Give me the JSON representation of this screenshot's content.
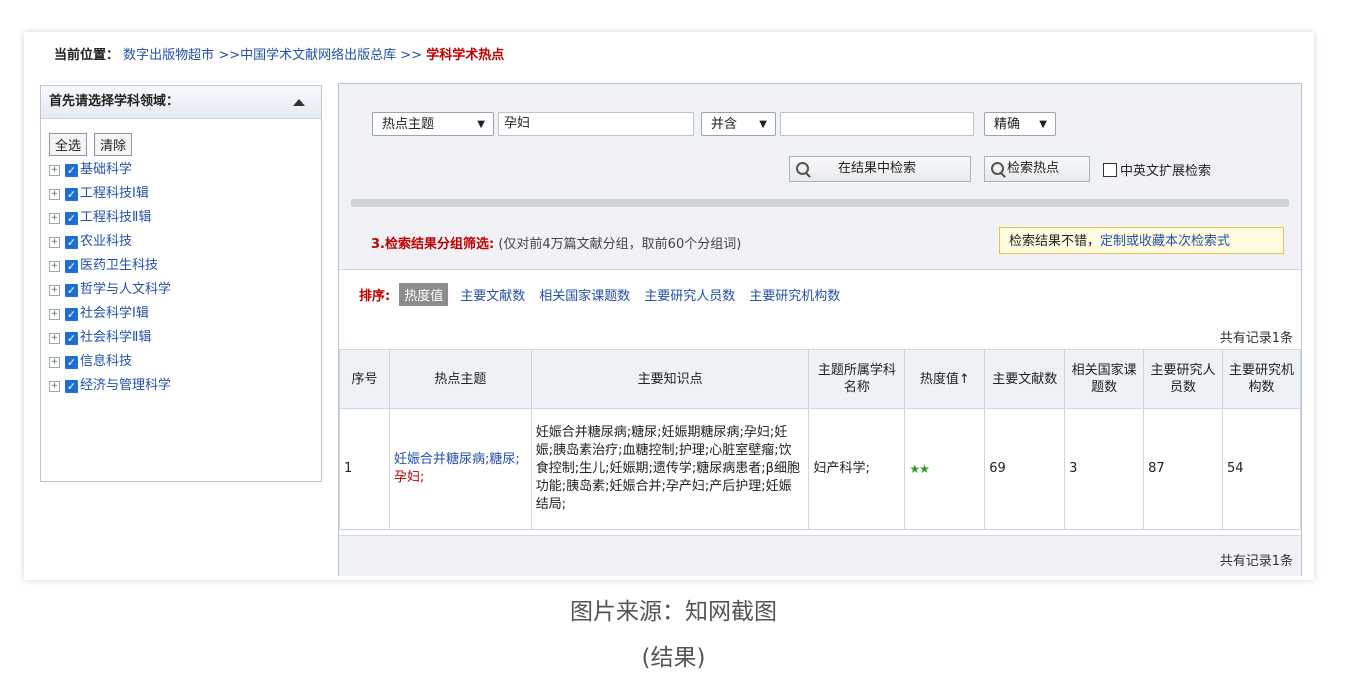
{
  "breadcrumb": {
    "label": "当前位置：",
    "items": [
      "数字出版物超市",
      ">>",
      "中国学术文献网络出版总库",
      ">>"
    ],
    "current": "学科学术热点"
  },
  "sidebar": {
    "title": "首先请选择学科领域：",
    "select_all": "全选",
    "clear": "清除",
    "items": [
      {
        "label": "基础科学",
        "checked": true
      },
      {
        "label": "工程科技Ⅰ辑",
        "checked": true
      },
      {
        "label": "工程科技Ⅱ辑",
        "checked": true
      },
      {
        "label": "农业科技",
        "checked": true
      },
      {
        "label": "医药卫生科技",
        "checked": true
      },
      {
        "label": "哲学与人文科学",
        "checked": true
      },
      {
        "label": "社会科学Ⅰ辑",
        "checked": true
      },
      {
        "label": "社会科学Ⅱ辑",
        "checked": true
      },
      {
        "label": "信息科技",
        "checked": true
      },
      {
        "label": "经济与管理科学",
        "checked": true
      }
    ]
  },
  "search": {
    "field_select": "热点主题",
    "query": "孕妇",
    "logic_select": "并含",
    "query2": "",
    "match_select": "精确",
    "search_within_label": "在结果中检索",
    "search_hot_label": "检索热点",
    "expand_label": "中英文扩展检索",
    "expand_checked": false
  },
  "grouping": {
    "title": "3.检索结果分组筛选:",
    "note": "(仅对前4万篇文献分组，取前60个分组词)",
    "tip_text": "检索结果不错，",
    "tip_link": "定制或收藏本次检索式"
  },
  "sort": {
    "label": "排序:",
    "active": "热度值",
    "options": [
      "主要文献数",
      "相关国家课题数",
      "主要研究人员数",
      "主要研究机构数"
    ]
  },
  "record_count": "共有记录1条",
  "table": {
    "headers": [
      "序号",
      "热点主题",
      "主要知识点",
      "主题所属学科名称",
      "热度值↑",
      "主要文献数",
      "相关国家课题数",
      "主要研究人员数",
      "主要研究机构数"
    ],
    "rows": [
      {
        "index": "1",
        "topic_part1": "妊娠合并糖尿病;糖尿;",
        "topic_part2": "孕妇;",
        "knowledge": "妊娠合并糖尿病;糖尿;妊娠期糖尿病;孕妇;妊娠;胰岛素治疗;血糖控制;护理;心脏室壁瘤;饮食控制;生儿;妊娠期;遗传学;糖尿病患者;β细胞功能;胰岛素;妊娠合并;孕产妇;产后护理;妊娠结局;",
        "subject": "妇产科学;",
        "heat_stars": "★★",
        "docs": "69",
        "projects": "3",
        "researchers": "87",
        "institutions": "54"
      }
    ]
  },
  "caption": {
    "line1": "图片来源：知网截图",
    "line2": "(结果)"
  }
}
